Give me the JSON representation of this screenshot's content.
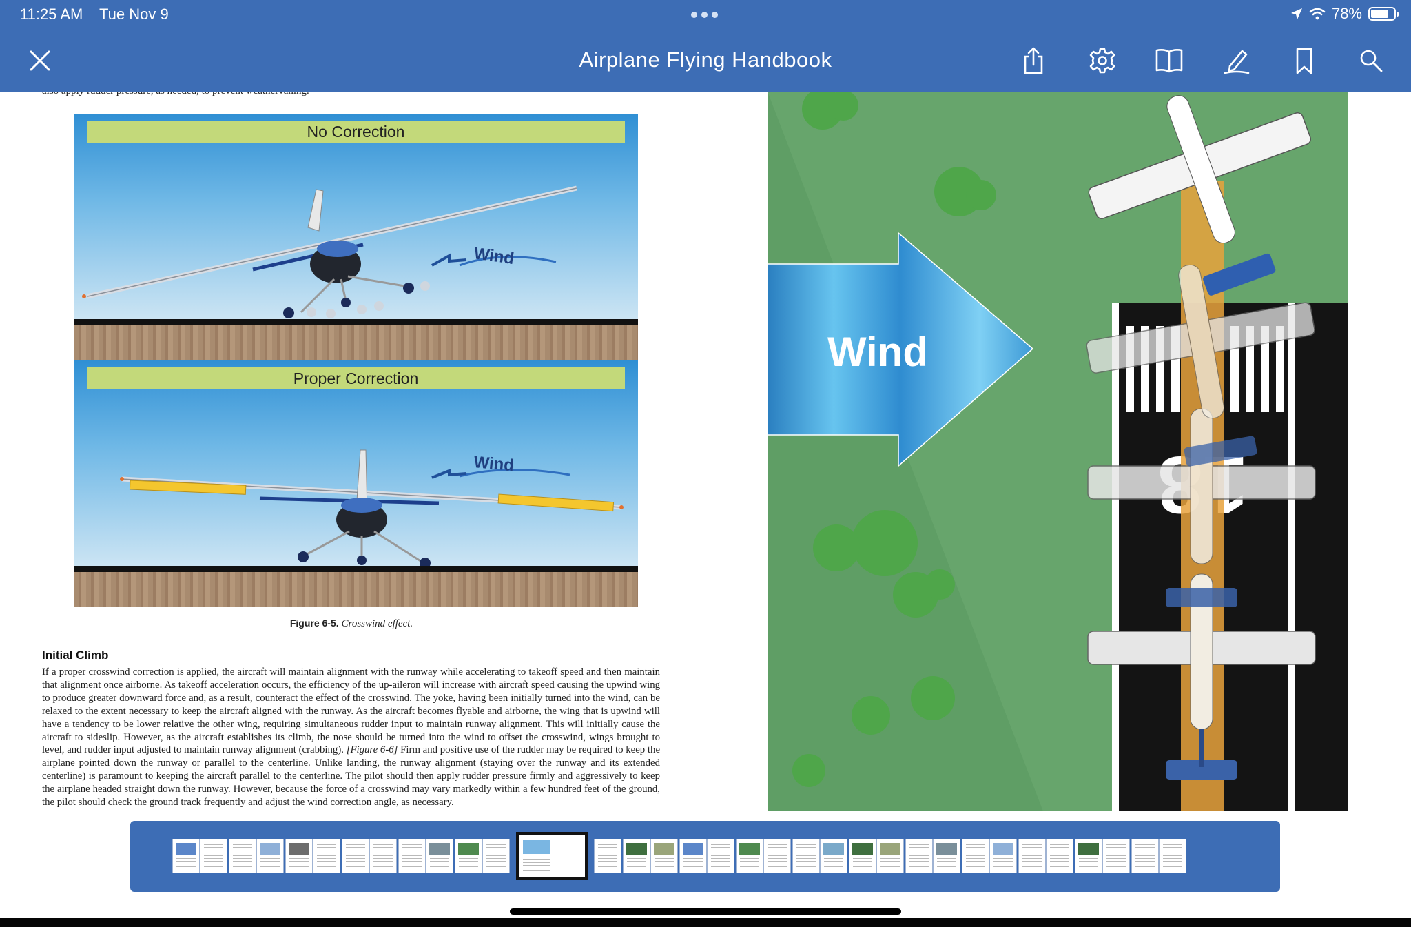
{
  "status_bar": {
    "time": "11:25 AM",
    "date": "Tue Nov 9",
    "battery": "78%",
    "battery_level": 0.78
  },
  "toolbar": {
    "title": "Airplane Flying Handbook",
    "icons": [
      "close-icon",
      "share-icon",
      "gear-icon",
      "book-icon",
      "pen-icon",
      "bookmark-icon",
      "search-icon"
    ]
  },
  "left_page": {
    "cut_text": "also apply rudder pressure, as needed, to prevent weathervaning.",
    "panels": [
      {
        "title": "No Correction",
        "wind_label": "Wind"
      },
      {
        "title": "Proper Correction",
        "wind_label": "Wind"
      }
    ],
    "caption_number": "Figure 6-5.",
    "caption_text": "Crosswind effect.",
    "section_heading": "Initial Climb",
    "body_pre": "If a proper crosswind correction is applied, the aircraft will maintain alignment with the runway while accelerating to takeoff speed and then maintain that alignment once airborne. As takeoff acceleration occurs, the efficiency of the up-aileron will increase with aircraft speed causing the upwind wing to produce greater downward force and, as a result, counteract the effect of the crosswind. The yoke, having been initially turned into the wind, can be relaxed to the extent necessary to keep the aircraft aligned with the runway. As the aircraft becomes flyable and airborne, the wing that is upwind will have a tendency to be lower relative the other wing, requiring simultaneous rudder input to maintain runway alignment. This will initially cause the aircraft to sideslip. However, as the aircraft establishes its climb, the nose should be turned into the wind to offset the crosswind, wings brought to level, and rudder input adjusted to maintain runway alignment (crabbing).",
    "body_ref": "[Figure 6-6]",
    "body_post": "Firm and positive use of the rudder may be required to keep the airplane pointed down the runway or parallel to the centerline. Unlike landing, the runway alignment (staying over the runway and its extended centerline) is paramount to keeping the aircraft parallel to the centerline. The pilot should then apply rudder pressure firmly and aggressively to keep the airplane headed straight down the runway. However, because the force of a crosswind may vary markedly within a few hundred feet of the ground, the pilot should check the ground track frequently and adjust the wind correction angle, as necessary."
  },
  "right_page": {
    "wind_label": "Wind",
    "runway_number": "18"
  }
}
